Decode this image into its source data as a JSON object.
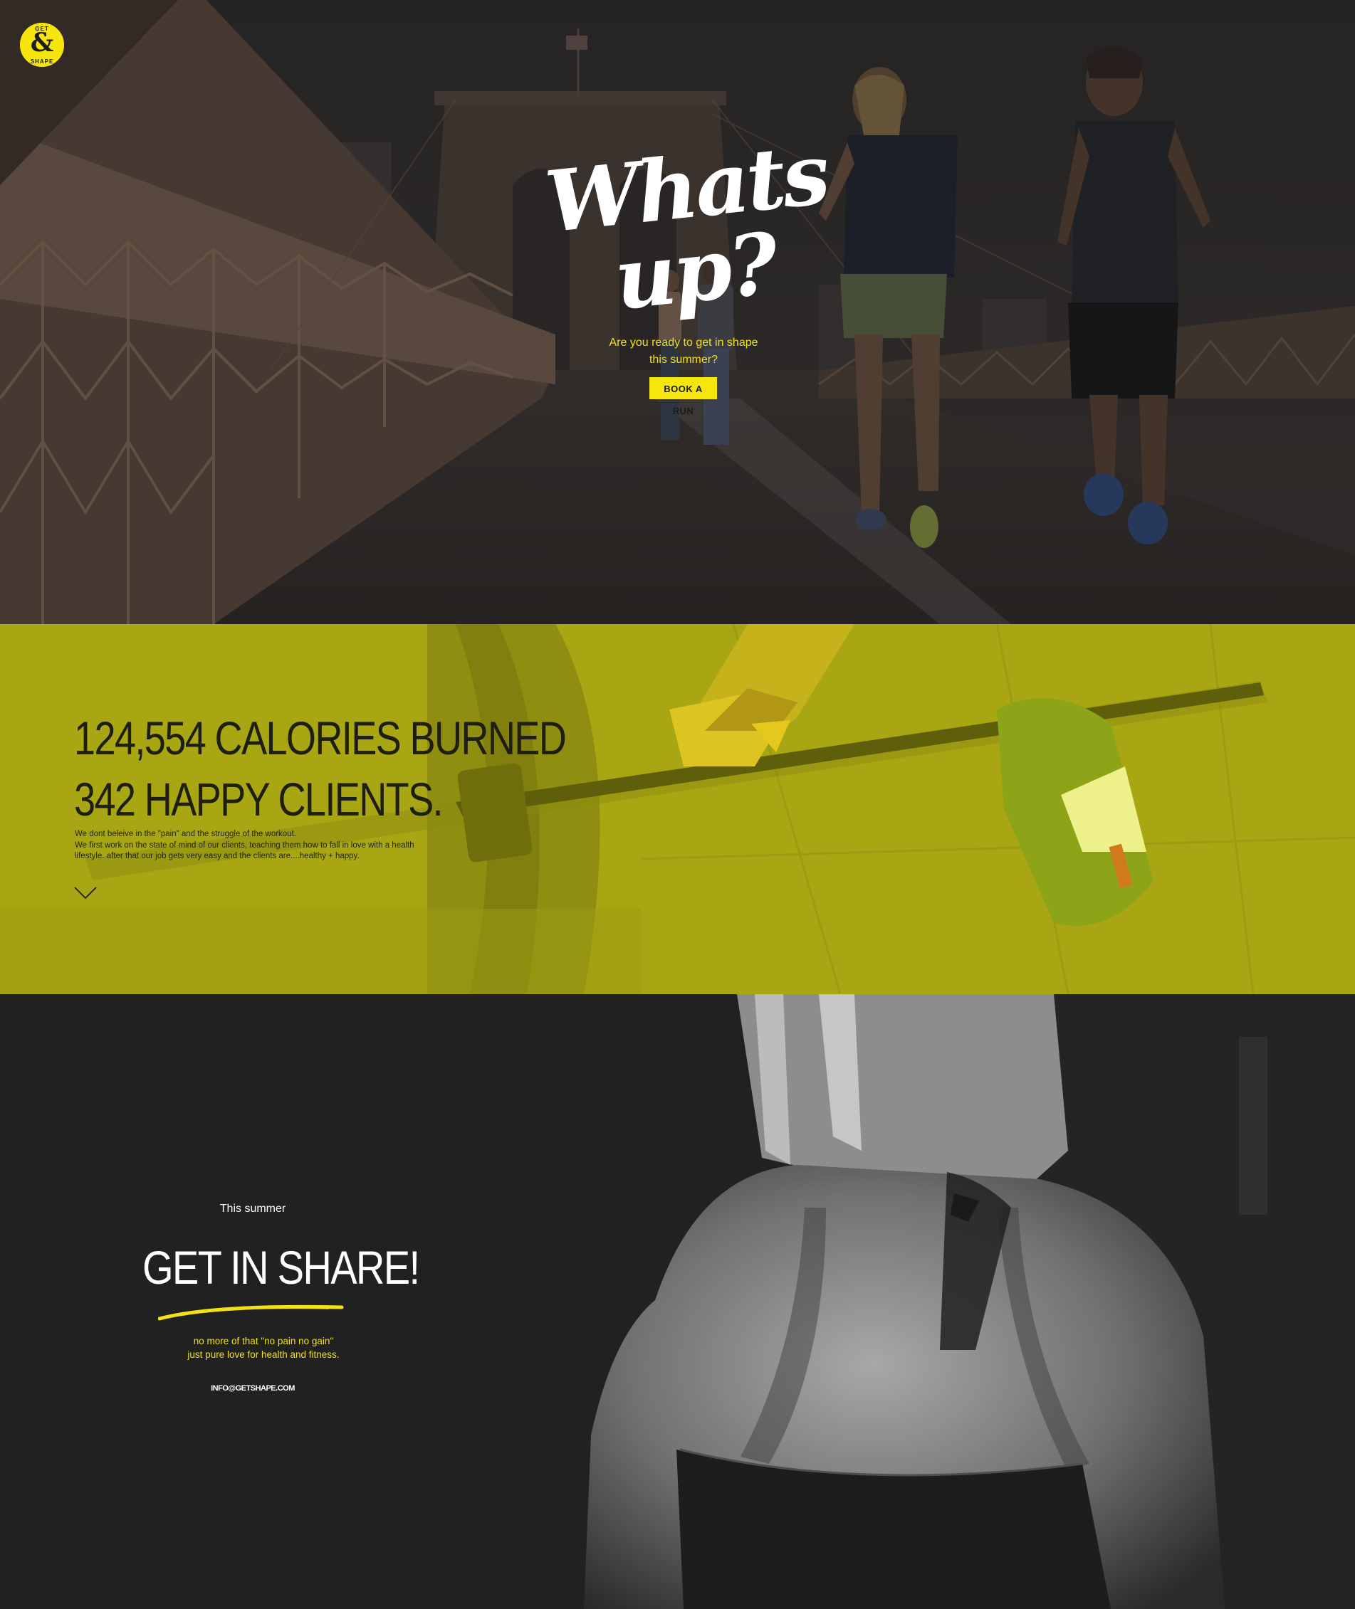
{
  "brand": {
    "logo_top": "GET",
    "logo_mark": "&",
    "logo_bottom": "SHAPE",
    "accent": "#f5e50a"
  },
  "hero": {
    "title": "Whats up?",
    "subtitle_line1": "Are you ready to get in shape",
    "subtitle_line2": "this summer?",
    "cta_label": "BOOK A RUN"
  },
  "stats": {
    "line1": "124,554 CALORIES BURNED",
    "line2": "342 HAPPY CLIENTS.",
    "para_line1": "We dont beleive in the \"pain\" and the struggle of the workout.",
    "para_line2": "We first work on the state of mind of our clients, teaching them how to fall in love with a health",
    "para_line3": "lifestyle. after that our job gets very easy and the clients are....healthy + happy.",
    "scroll_icon": "chevron-down-icon",
    "band_color": "#a7a612"
  },
  "contact": {
    "kicker": "This summer",
    "headline": "GET IN SHARE!",
    "text_line1": "no more of that \"no pain no gain\"",
    "text_line2": "just pure love for health and fitness.",
    "email": "INFO@GETSHAPE.COM"
  }
}
